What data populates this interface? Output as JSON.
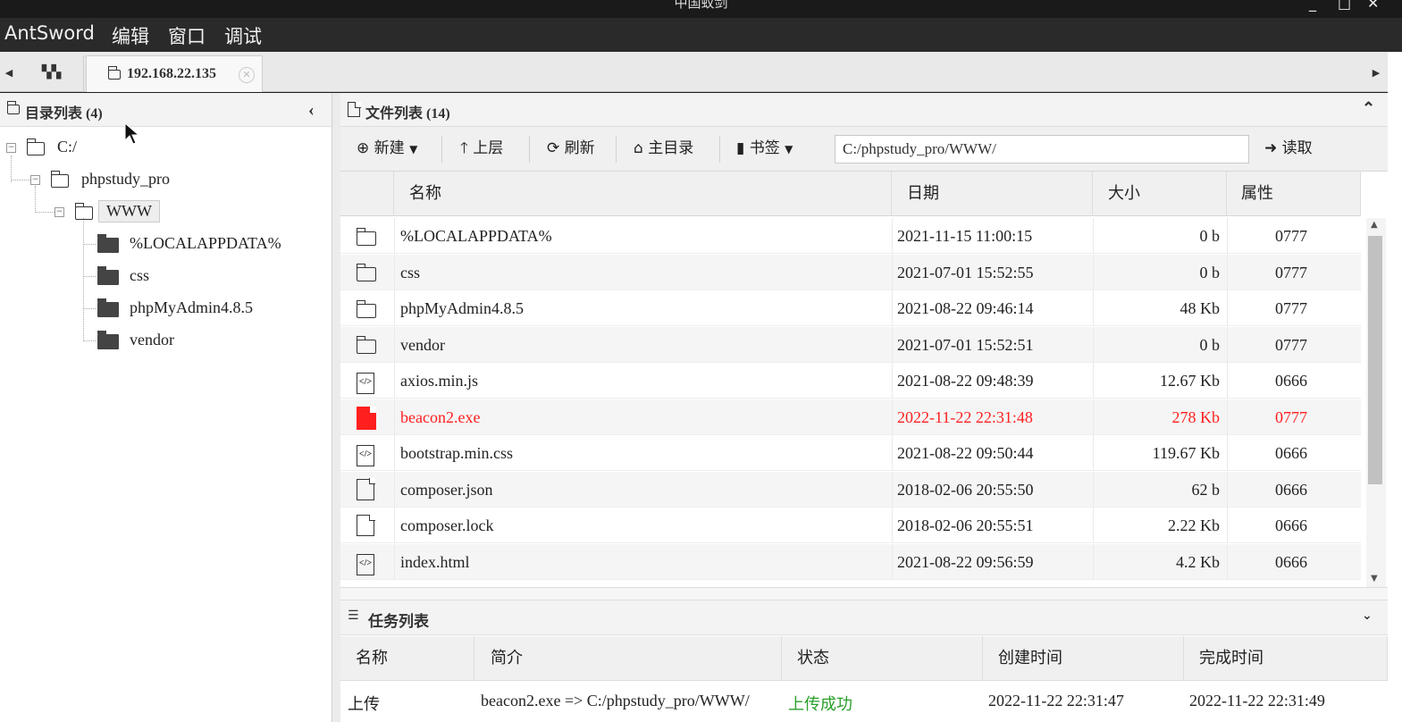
{
  "window": {
    "title": "中国蚁剑",
    "controls": [
      "_",
      "□",
      "✕"
    ]
  },
  "menubar": {
    "items": [
      "AntSword",
      "编辑",
      "窗口",
      "调试"
    ]
  },
  "tabs": {
    "active_host": "192.168.22.135"
  },
  "dir_panel": {
    "title": "目录列表 (4)",
    "collapse_icon": "chevron-left-icon",
    "tree": [
      {
        "label": "C:/"
      },
      {
        "label": "phpstudy_pro"
      },
      {
        "label": "WWW"
      },
      {
        "label": "%LOCALAPPDATA%"
      },
      {
        "label": "css"
      },
      {
        "label": "phpMyAdmin4.8.5"
      },
      {
        "label": "vendor"
      }
    ]
  },
  "file_panel": {
    "title": "文件列表 (14)",
    "toolbar": {
      "new": "新建",
      "up": "上层",
      "refresh": "刷新",
      "home": "主目录",
      "bookmark": "书签",
      "read": "读取",
      "path": "C:/phpstudy_pro/WWW/"
    },
    "columns": [
      "名称",
      "日期",
      "大小",
      "属性"
    ],
    "rows": [
      {
        "name": "%LOCALAPPDATA%",
        "date": "2021-11-15 11:00:15",
        "size": "0 b",
        "attr": "0777",
        "icon": "folder-icon"
      },
      {
        "name": "css",
        "date": "2021-07-01 15:52:55",
        "size": "0 b",
        "attr": "0777",
        "icon": "folder-icon"
      },
      {
        "name": "phpMyAdmin4.8.5",
        "date": "2021-08-22 09:46:14",
        "size": "48 Kb",
        "attr": "0777",
        "icon": "folder-icon"
      },
      {
        "name": "vendor",
        "date": "2021-07-01 15:52:51",
        "size": "0 b",
        "attr": "0777",
        "icon": "folder-icon"
      },
      {
        "name": "axios.min.js",
        "date": "2021-08-22 09:48:39",
        "size": "12.67 Kb",
        "attr": "0666",
        "icon": "code-file-icon"
      },
      {
        "name": "beacon2.exe",
        "date": "2022-11-22 22:31:48",
        "size": "278 Kb",
        "attr": "0777",
        "icon": "red-file-icon",
        "highlight": "#ff1f1f"
      },
      {
        "name": "bootstrap.min.css",
        "date": "2021-08-22 09:50:44",
        "size": "119.67 Kb",
        "attr": "0666",
        "icon": "code-file-icon"
      },
      {
        "name": "composer.json",
        "date": "2018-02-06 20:55:50",
        "size": "62 b",
        "attr": "0666",
        "icon": "file-icon"
      },
      {
        "name": "composer.lock",
        "date": "2018-02-06 20:55:51",
        "size": "2.22 Kb",
        "attr": "0666",
        "icon": "file-icon"
      },
      {
        "name": "index.html",
        "date": "2021-08-22 09:56:59",
        "size": "4.2 Kb",
        "attr": "0666",
        "icon": "code-file-icon"
      }
    ]
  },
  "task_panel": {
    "title": "任务列表",
    "columns": [
      "名称",
      "简介",
      "状态",
      "创建时间",
      "完成时间"
    ],
    "rows": [
      {
        "name": "上传",
        "desc": "beacon2.exe => C:/phpstudy_pro/WWW/",
        "status": "上传成功",
        "status_color": "#2aa02a",
        "created": "2022-11-22 22:31:47",
        "finished": "2022-11-22 22:31:49"
      }
    ]
  }
}
